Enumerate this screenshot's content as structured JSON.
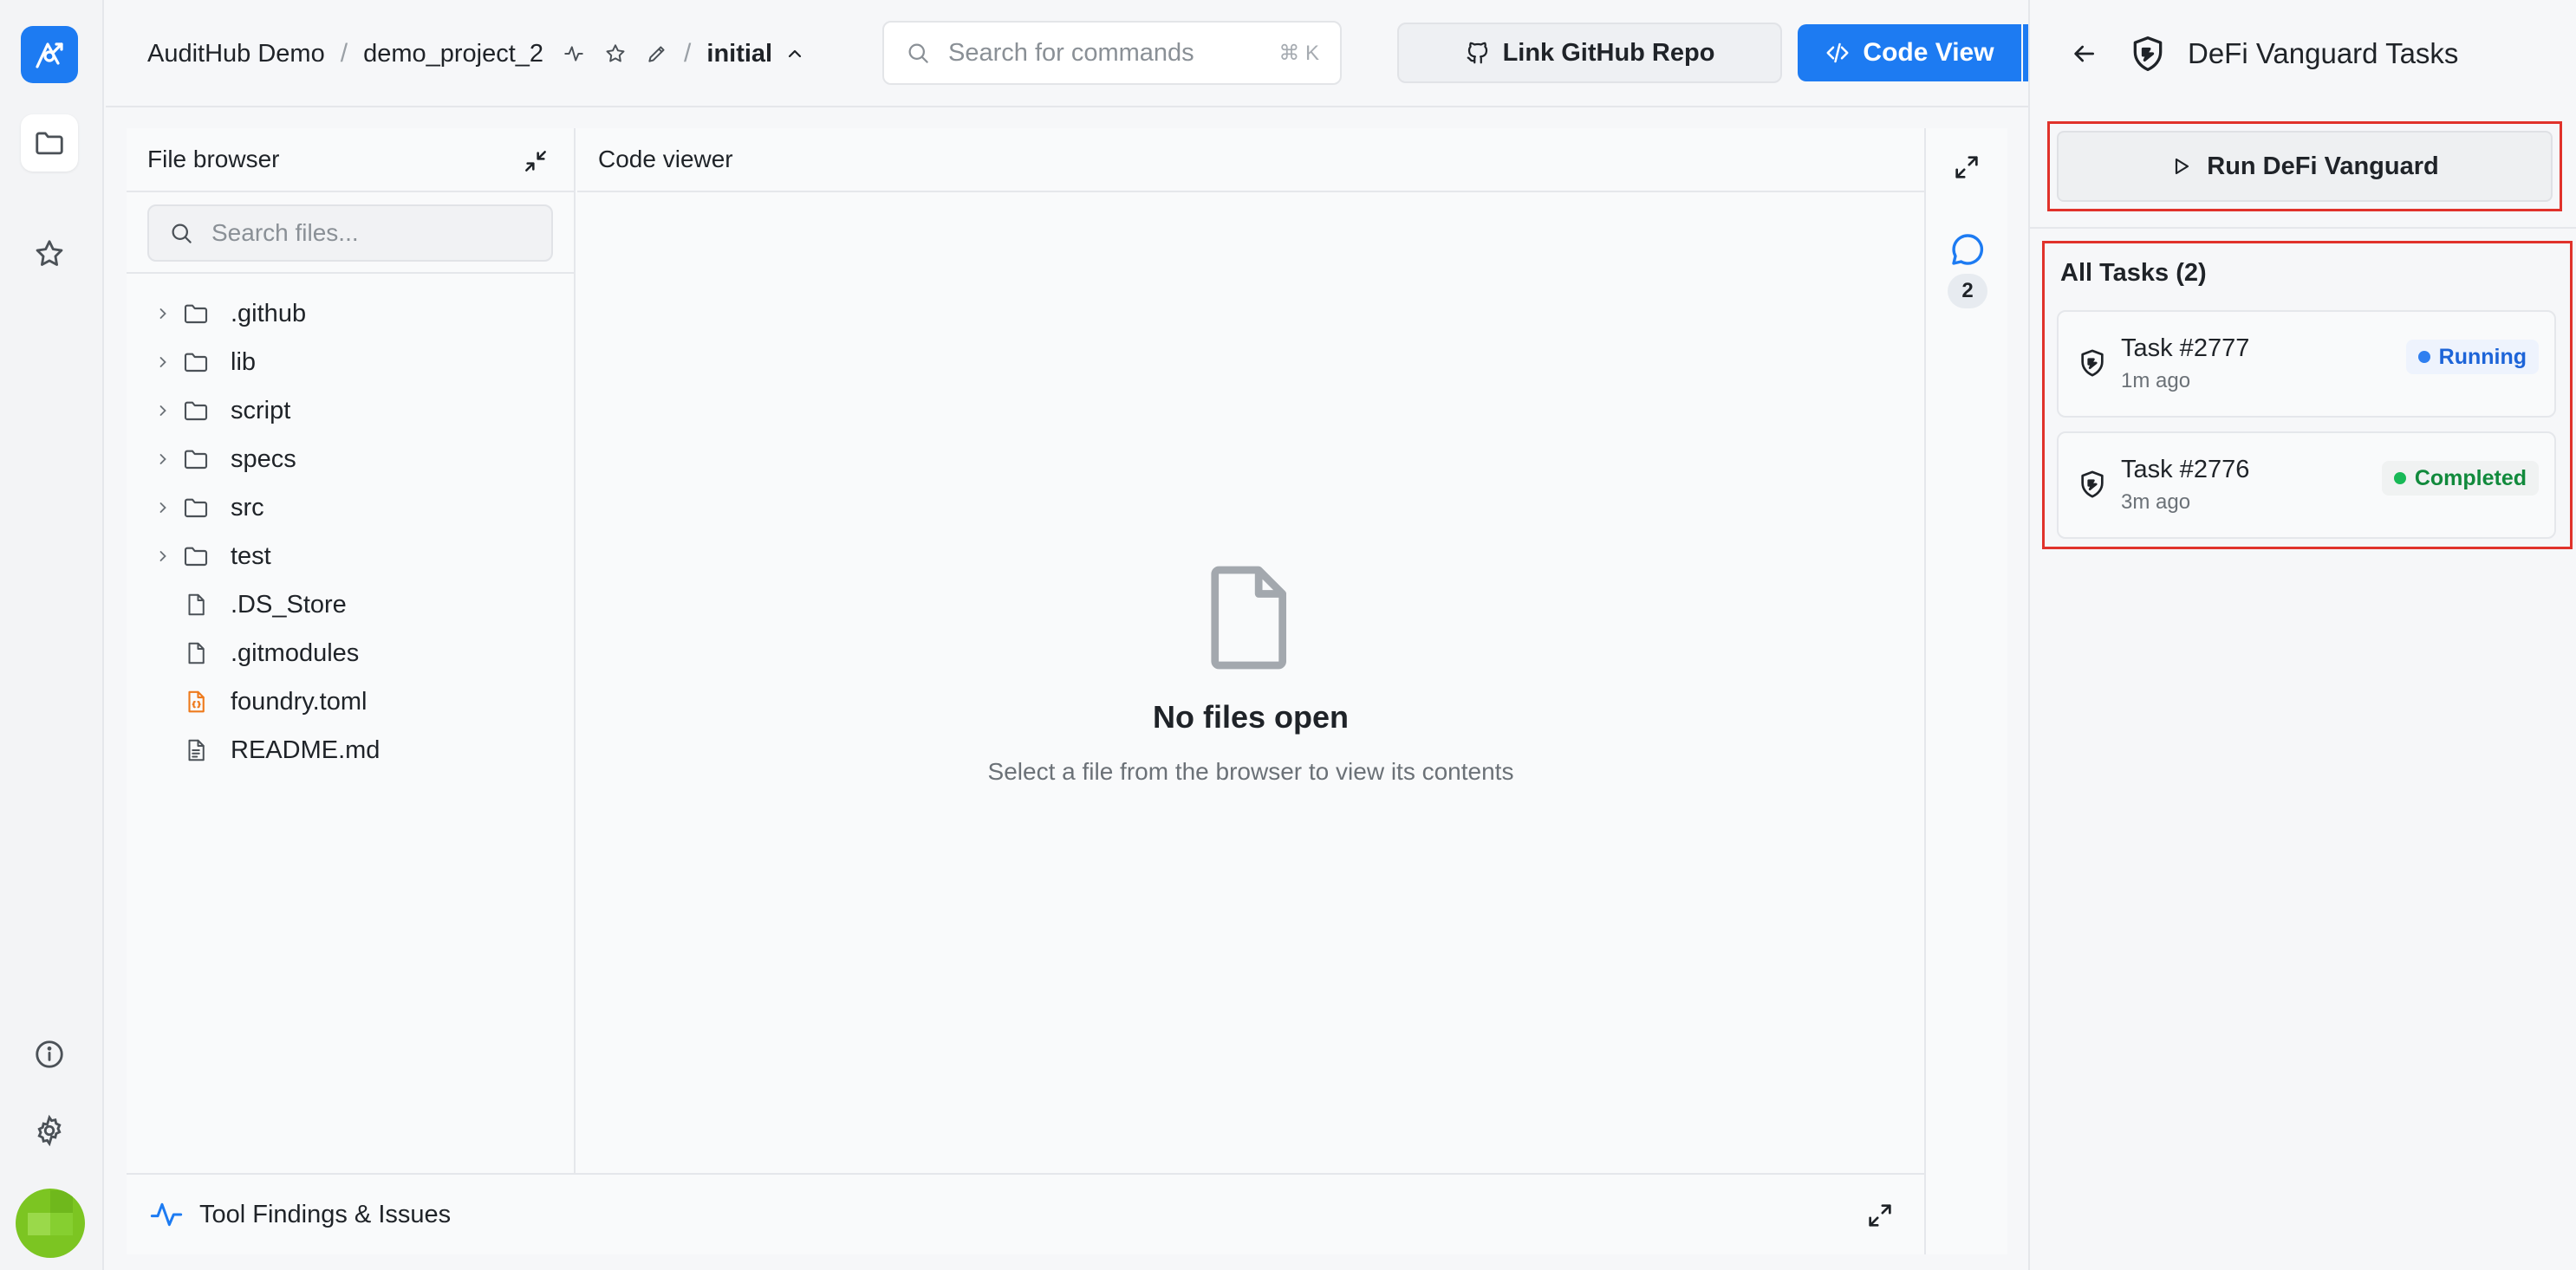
{
  "header": {
    "org": "AuditHub Demo",
    "separator": "/",
    "project": "demo_project_2",
    "branch": "initial",
    "search_placeholder": "Search for commands",
    "search_shortcut": "⌘ K",
    "link_github_label": "Link GitHub Repo",
    "code_view_label": "Code View"
  },
  "file_browser": {
    "title": "File browser",
    "search_placeholder": "Search files...",
    "items": [
      {
        "name": ".github",
        "type": "folder"
      },
      {
        "name": "lib",
        "type": "folder"
      },
      {
        "name": "script",
        "type": "folder"
      },
      {
        "name": "specs",
        "type": "folder"
      },
      {
        "name": "src",
        "type": "folder"
      },
      {
        "name": "test",
        "type": "folder"
      },
      {
        "name": ".DS_Store",
        "type": "file"
      },
      {
        "name": ".gitmodules",
        "type": "file"
      },
      {
        "name": "foundry.toml",
        "type": "config"
      },
      {
        "name": "README.md",
        "type": "doc"
      }
    ]
  },
  "code_viewer": {
    "title": "Code viewer",
    "empty_title": "No files open",
    "empty_subtitle": "Select a file from the browser to view its contents"
  },
  "side_tools": {
    "comment_count": "2"
  },
  "findings": {
    "label": "Tool Findings & Issues"
  },
  "right_panel": {
    "title": "DeFi Vanguard Tasks",
    "run_label": "Run DeFi Vanguard",
    "tasks_title": "All Tasks (2)",
    "tasks": [
      {
        "name": "Task #2777",
        "time": "1m ago",
        "status": "Running"
      },
      {
        "name": "Task #2776",
        "time": "3m ago",
        "status": "Completed"
      }
    ]
  },
  "colors": {
    "accent": "#1d7bf2",
    "running": "#2f7ff0",
    "completed": "#18b957",
    "highlight_border": "#e0322b"
  }
}
